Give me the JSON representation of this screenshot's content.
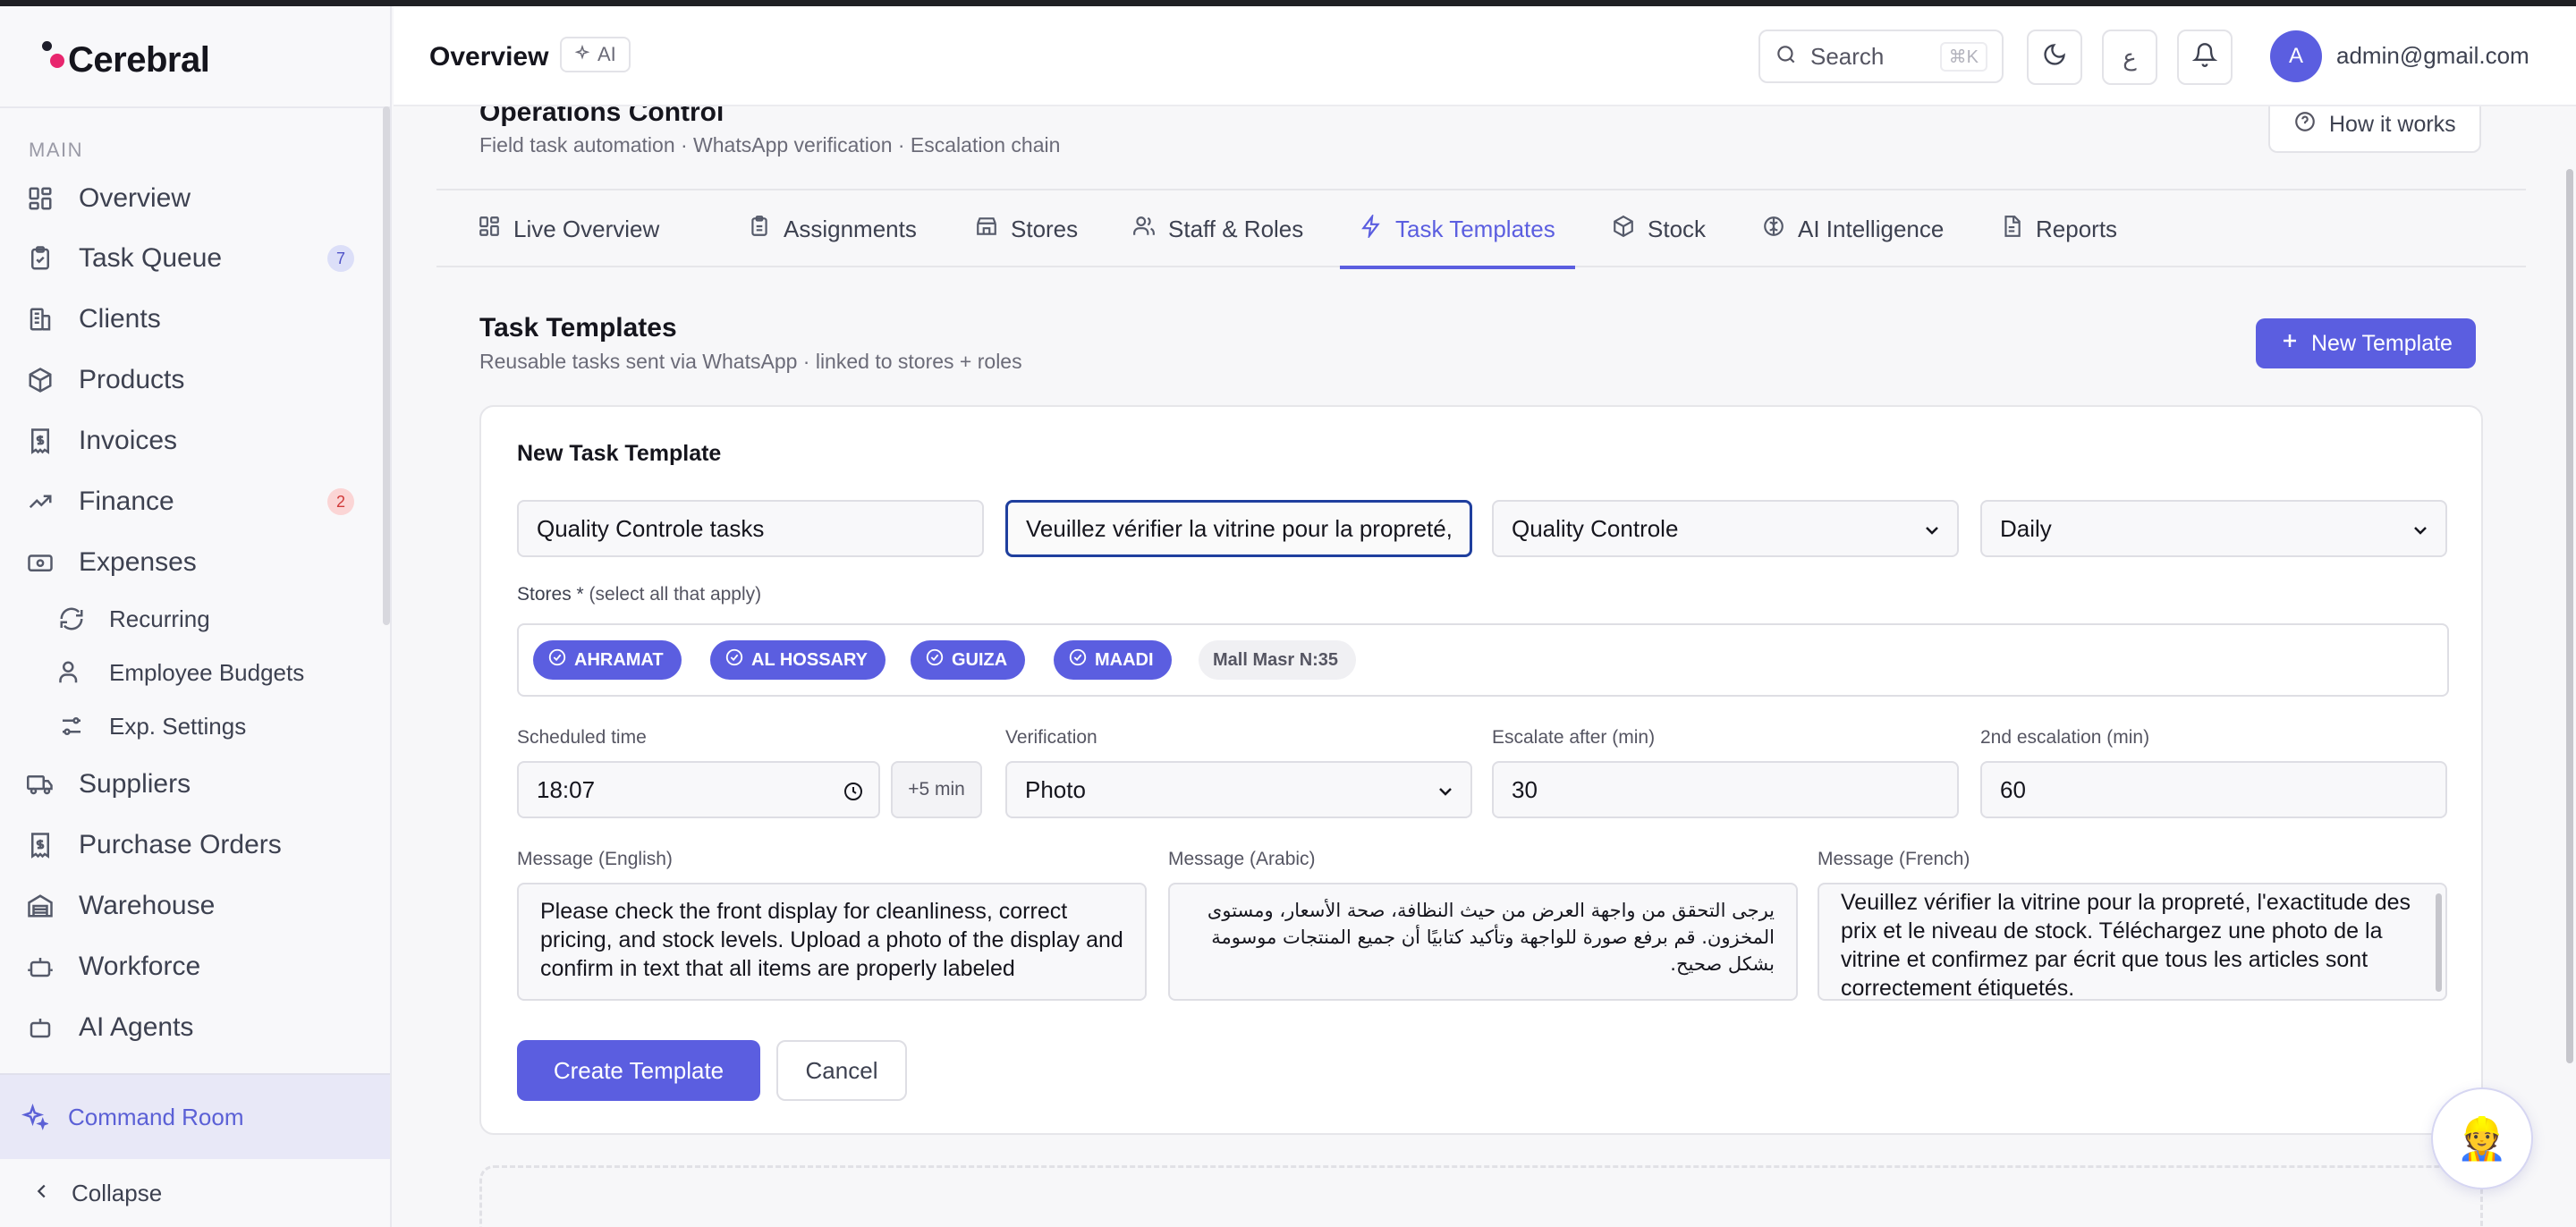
{
  "app": {
    "brand": "Cerebral"
  },
  "sidebar": {
    "section_label": "MAIN",
    "items": [
      {
        "label": "Overview",
        "icon": "grid-icon"
      },
      {
        "label": "Task Queue",
        "icon": "clipboard-icon",
        "badge": "7"
      },
      {
        "label": "Clients",
        "icon": "building-icon"
      },
      {
        "label": "Products",
        "icon": "box-icon"
      },
      {
        "label": "Invoices",
        "icon": "invoice-icon"
      },
      {
        "label": "Finance",
        "icon": "trend-icon",
        "badge": "2"
      },
      {
        "label": "Expenses",
        "icon": "wallet-icon"
      }
    ],
    "sub_items": [
      {
        "label": "Recurring",
        "icon": "refresh-icon"
      },
      {
        "label": "Employee Budgets",
        "icon": "users-icon"
      },
      {
        "label": "Exp. Settings",
        "icon": "sliders-icon"
      }
    ],
    "items_lower": [
      {
        "label": "Suppliers",
        "icon": "truck-icon"
      },
      {
        "label": "Purchase Orders",
        "icon": "receipt-icon"
      },
      {
        "label": "Warehouse",
        "icon": "warehouse-icon"
      },
      {
        "label": "Workforce",
        "icon": "robot-icon"
      },
      {
        "label": "AI Agents",
        "icon": "bot-icon"
      }
    ],
    "command_room": "Command Room",
    "collapse": "Collapse"
  },
  "header": {
    "title": "Overview",
    "ai_badge": "AI",
    "search_placeholder": "Search",
    "search_shortcut": "⌘K",
    "lang_button": "ع",
    "avatar_initial": "A",
    "email": "admin@gmail.com"
  },
  "ops": {
    "title": "Operations Control",
    "subtitle": "Field task automation · WhatsApp verification · Escalation chain",
    "how_it_works": "How it works"
  },
  "tabs": [
    {
      "label": "Live Overview",
      "icon": "grid-icon"
    },
    {
      "label": "Assignments",
      "icon": "clipboard-icon"
    },
    {
      "label": "Stores",
      "icon": "store-icon"
    },
    {
      "label": "Staff & Roles",
      "icon": "users-icon"
    },
    {
      "label": "Task Templates",
      "icon": "bolt-icon",
      "active": true
    },
    {
      "label": "Stock",
      "icon": "box-icon"
    },
    {
      "label": "AI Intelligence",
      "icon": "brain-icon"
    },
    {
      "label": "Reports",
      "icon": "document-icon"
    }
  ],
  "templates": {
    "title": "Task Templates",
    "subtitle": "Reusable tasks sent via WhatsApp · linked to stores + roles",
    "new_button": "New Template"
  },
  "form": {
    "title": "New Task Template",
    "name_value": "Quality Controle tasks",
    "short_message_value": "Veuillez vérifier la vitrine pour la propreté,",
    "role_value": "Quality Controle",
    "frequency_value": "Daily",
    "stores_label": "Stores *",
    "stores_hint": "(select all that apply)",
    "stores": [
      {
        "label": "AHRAMAT",
        "selected": true
      },
      {
        "label": "AL HOSSARY",
        "selected": true
      },
      {
        "label": "GUIZA",
        "selected": true
      },
      {
        "label": "MAADI",
        "selected": true
      },
      {
        "label": "Mall Masr N:35",
        "selected": false
      }
    ],
    "scheduled_time_label": "Scheduled time",
    "scheduled_time_value": "18:07",
    "plus_five": "+5 min",
    "verification_label": "Verification",
    "verification_value": "Photo",
    "escalate_label": "Escalate after (min)",
    "escalate_value": "30",
    "second_escalation_label": "2nd escalation (min)",
    "second_escalation_value": "60",
    "message_en_label": "Message (English)",
    "message_en": "Please check the front display for cleanliness, correct pricing, and stock levels. Upload a photo of the display and confirm in text that all items are properly labeled",
    "message_ar_label": "Message (Arabic)",
    "message_ar": "يرجى التحقق من واجهة العرض من حيث النظافة، صحة الأسعار، ومستوى المخزون. قم برفع صورة للواجهة وتأكيد كتابيًا أن جميع المنتجات موسومة بشكل صحيح.",
    "message_fr_label": "Message (French)",
    "message_fr": "Veuillez vérifier la vitrine pour la propreté, l'exactitude des prix et le niveau de stock. Téléchargez une photo de la vitrine et confirmez par écrit que tous les articles sont correctement étiquetés.",
    "create_button": "Create Template",
    "cancel_button": "Cancel"
  },
  "fab": {
    "emoji": "👷"
  },
  "colors": {
    "accent": "#5b5ee0",
    "brand_dot": "#e8266e",
    "badge_red": "#d03a3a"
  }
}
